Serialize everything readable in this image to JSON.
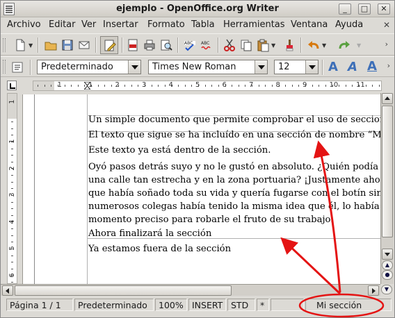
{
  "window": {
    "title": "ejemplo - OpenOffice.org Writer",
    "minimize_glyph": "_",
    "maximize_glyph": "□",
    "close_glyph": "✕"
  },
  "menu": {
    "items": [
      "Archivo",
      "Editar",
      "Ver",
      "Insertar",
      "Formato",
      "Tabla",
      "Herramientas",
      "Ventana",
      "Ayuda"
    ],
    "close_glyph": "✕"
  },
  "toolbar": {
    "icons": [
      "new-document-icon",
      "open-folder-icon",
      "save-icon",
      "email-icon",
      "edit-mode-icon",
      "export-pdf-icon",
      "print-icon",
      "page-preview-icon",
      "spellcheck-icon",
      "autospellcheck-icon",
      "cut-icon",
      "copy-icon",
      "paste-icon",
      "format-paintbrush-icon",
      "undo-icon",
      "redo-icon"
    ]
  },
  "format_bar": {
    "paragraph_style": "Predeterminado",
    "font_name": "Times New Roman",
    "font_size": "12",
    "bold_label": "A",
    "italic_label": "A",
    "underline_label": "A"
  },
  "ruler": {
    "labels": [
      "1",
      "1",
      "2",
      "3",
      "4",
      "5",
      "6",
      "7",
      "8",
      "9",
      "10",
      "11"
    ],
    "vertical_labels": [
      "1",
      "1",
      "2",
      "3",
      "4",
      "5",
      "6"
    ]
  },
  "document": {
    "lines": [
      "Un simple documento que permite comprobar el uso de secciones",
      "El texto que sigue se ha incluído en una sección de nombre “Mi se",
      "Este texto ya está dentro de la sección.",
      "Oyó pasos detrás suyo y no le gustó en absoluto. ¿Quién podía seg",
      "una calle tan estrecha y en la zona portuaria? ¡Justamente ahora q",
      "que había soñado toda su vida y quería fugarse con el botín sin de",
      "numerosos colegas había tenido la misma idea que él, lo había obs",
      "momento preciso para robarle el fruto de su trabajo.",
      "Ahora finalizará la sección",
      "Ya estamos fuera de la sección"
    ]
  },
  "statusbar": {
    "page": "Página  1 / 1",
    "page_style": "Predeterminado",
    "zoom": "100%",
    "insert_mode": "INSERT",
    "selection_mode": "STD",
    "modified": "*",
    "section_name": "Mi sección"
  },
  "colors": {
    "annotation": "#e41414",
    "window_bg": "#dcdad5",
    "paper": "#ffffff"
  }
}
